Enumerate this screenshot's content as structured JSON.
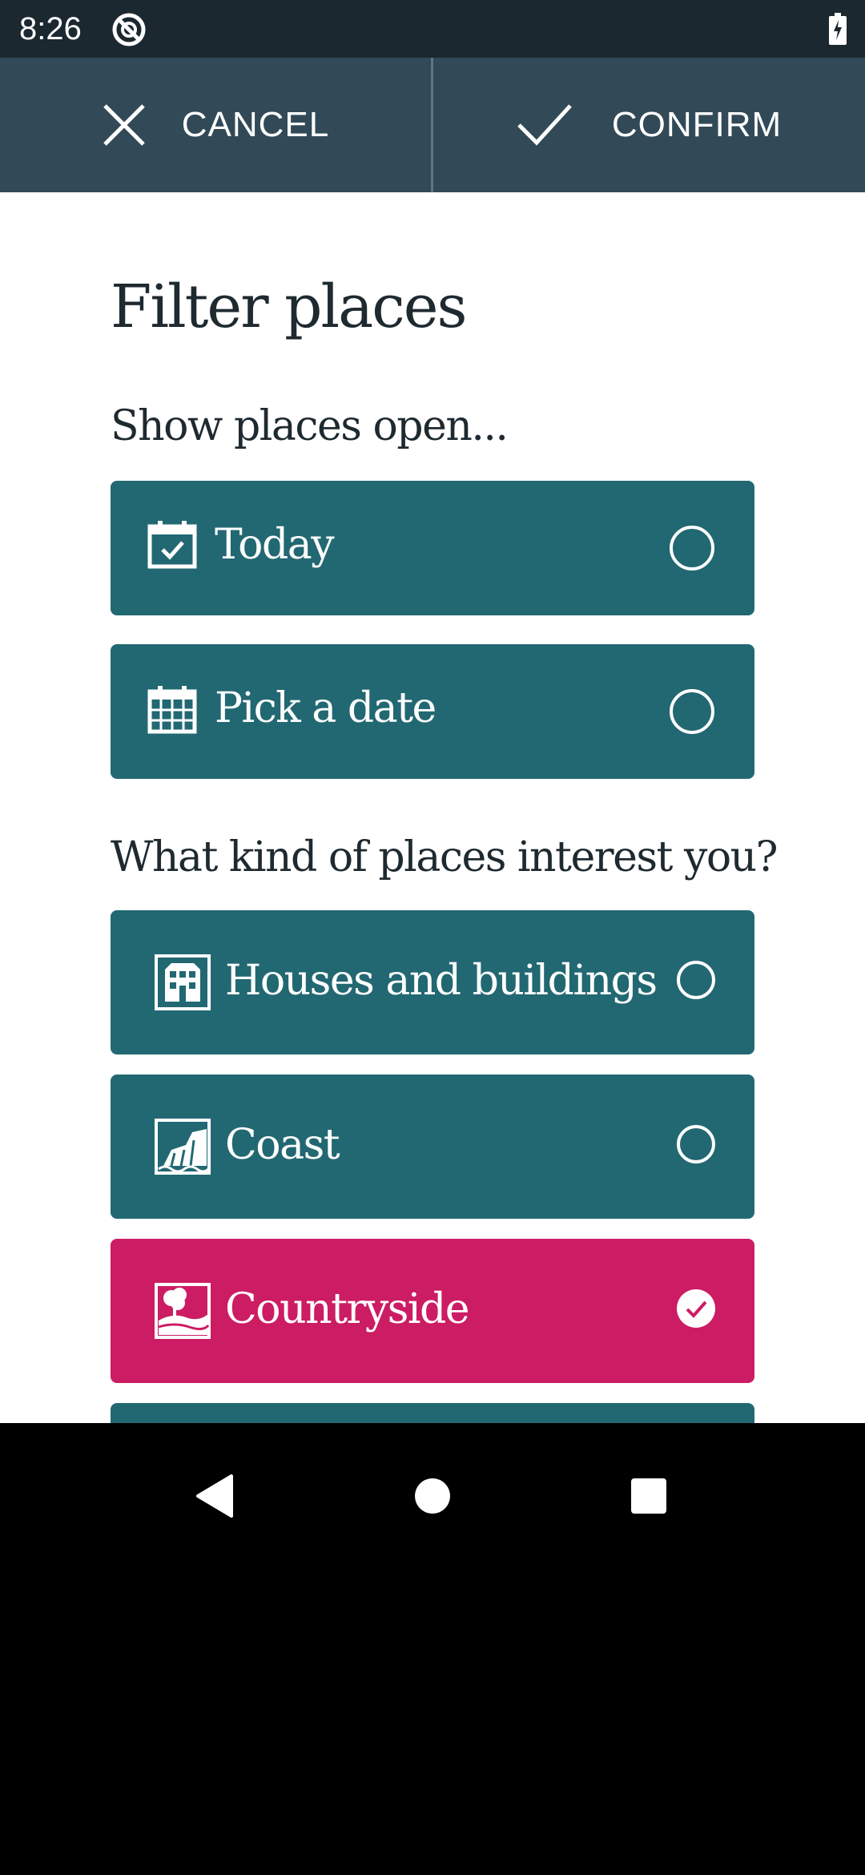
{
  "status_bar": {
    "time": "8:26",
    "app_icon": "notification-app-icon",
    "battery_icon": "battery-charging-icon"
  },
  "action_bar": {
    "cancel_label": "CANCEL",
    "cancel_icon": "close-icon",
    "confirm_label": "CONFIRM",
    "confirm_icon": "check-icon"
  },
  "page": {
    "title": "Filter places"
  },
  "open_section": {
    "heading": "Show places open...",
    "options": [
      {
        "label": "Today",
        "icon": "calendar-check-icon",
        "selected": false
      },
      {
        "label": "Pick a date",
        "icon": "calendar-grid-icon",
        "selected": false
      }
    ]
  },
  "interest_section": {
    "heading": "What kind of places interest you?",
    "options": [
      {
        "label": "Houses and buildings",
        "icon": "building-icon",
        "selected": false
      },
      {
        "label": "Coast",
        "icon": "coast-icon",
        "selected": false
      },
      {
        "label": "Countryside",
        "icon": "countryside-icon",
        "selected": true
      }
    ]
  },
  "colors": {
    "status_bar": "#1c2830",
    "action_bar": "#324a57",
    "option_default": "#226872",
    "option_selected": "#cc1c64",
    "text_dark": "#1e2a30"
  },
  "nav_bar": {
    "back_icon": "back-icon",
    "home_icon": "home-icon",
    "recents_icon": "recents-icon"
  }
}
